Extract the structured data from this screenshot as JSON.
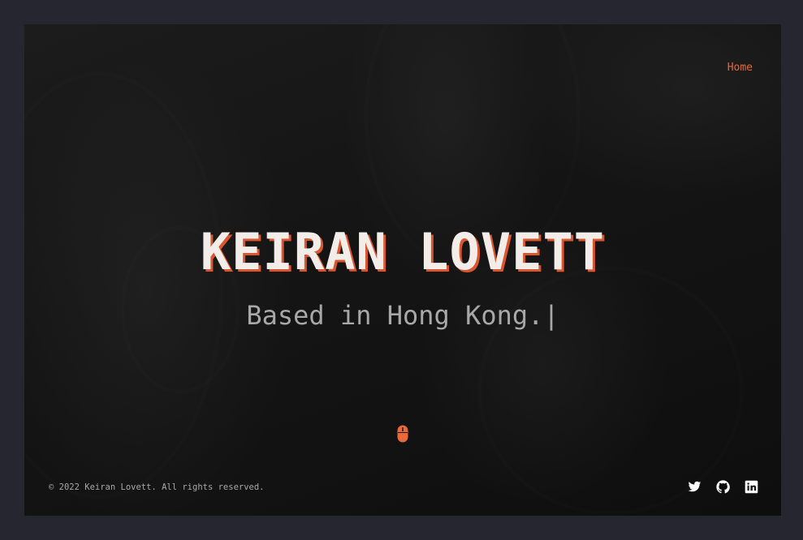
{
  "nav": {
    "items": [
      {
        "label": "Home"
      }
    ]
  },
  "hero": {
    "name": "KEIRAN LOVETT",
    "tagline": "Based in Hong Kong.|"
  },
  "scroll": {
    "icon": "mouse-icon"
  },
  "footer": {
    "copyright": "© 2022 Keiran Lovett. All rights reserved.",
    "socials": [
      {
        "icon": "twitter-icon"
      },
      {
        "icon": "github-icon"
      },
      {
        "icon": "linkedin-icon"
      }
    ]
  },
  "colors": {
    "accent": "#e8693a",
    "page_background": "#262630",
    "hero_background": "#141414",
    "name_text": "#f2ede8",
    "name_shadow": "#d9562e",
    "muted_text": "#a8a8a8"
  }
}
